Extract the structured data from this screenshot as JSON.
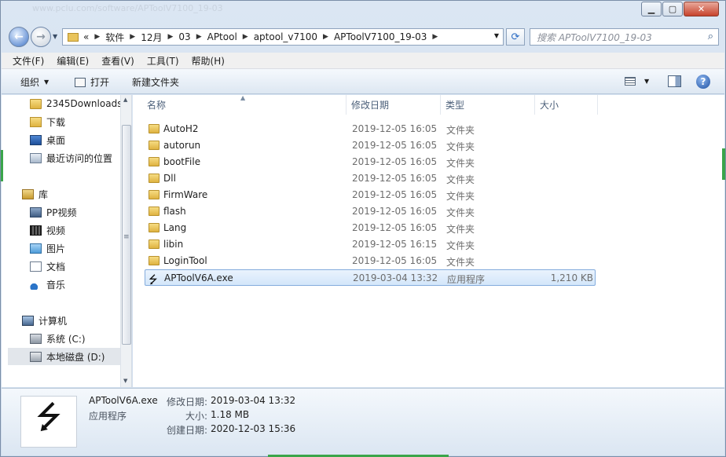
{
  "window": {
    "title": "www.pclu.com/software/APToolV7100_19-03"
  },
  "address": {
    "overflow": "«",
    "crumbs": [
      "软件",
      "12月",
      "03",
      "APtool",
      "aptool_v7100",
      "APToolV7100_19-03"
    ]
  },
  "search": {
    "placeholder": "搜索 APToolV7100_19-03"
  },
  "menu": [
    "文件(F)",
    "编辑(E)",
    "查看(V)",
    "工具(T)",
    "帮助(H)"
  ],
  "toolbar": {
    "organize": "组织",
    "open": "打开",
    "new_folder": "新建文件夹"
  },
  "nav": {
    "items": [
      {
        "label": "2345Downloads",
        "icon": "folder-icon"
      },
      {
        "label": "下载",
        "icon": "download-folder-icon"
      },
      {
        "label": "桌面",
        "icon": "desktop-icon"
      },
      {
        "label": "最近访问的位置",
        "icon": "recent-places-icon"
      },
      {
        "label": "库",
        "icon": "library-icon"
      },
      {
        "label": "PP视频",
        "icon": "pp-video-icon"
      },
      {
        "label": "视频",
        "icon": "video-library-icon"
      },
      {
        "label": "图片",
        "icon": "pictures-icon"
      },
      {
        "label": "文档",
        "icon": "documents-icon"
      },
      {
        "label": "音乐",
        "icon": "music-icon"
      },
      {
        "label": "计算机",
        "icon": "computer-icon"
      },
      {
        "label": "系统 (C:)",
        "icon": "drive-c-icon"
      },
      {
        "label": "本地磁盘 (D:)",
        "icon": "drive-d-icon"
      }
    ]
  },
  "columns": {
    "name": "名称",
    "date": "修改日期",
    "type": "类型",
    "size": "大小"
  },
  "files": [
    {
      "name": "AutoH2",
      "date": "2019-12-05 16:05",
      "type": "文件夹",
      "size": ""
    },
    {
      "name": "autorun",
      "date": "2019-12-05 16:05",
      "type": "文件夹",
      "size": ""
    },
    {
      "name": "bootFile",
      "date": "2019-12-05 16:05",
      "type": "文件夹",
      "size": ""
    },
    {
      "name": "Dll",
      "date": "2019-12-05 16:05",
      "type": "文件夹",
      "size": ""
    },
    {
      "name": "FirmWare",
      "date": "2019-12-05 16:05",
      "type": "文件夹",
      "size": ""
    },
    {
      "name": "flash",
      "date": "2019-12-05 16:05",
      "type": "文件夹",
      "size": ""
    },
    {
      "name": "Lang",
      "date": "2019-12-05 16:05",
      "type": "文件夹",
      "size": ""
    },
    {
      "name": "libin",
      "date": "2019-12-05 16:15",
      "type": "文件夹",
      "size": ""
    },
    {
      "name": "LoginTool",
      "date": "2019-12-05 16:05",
      "type": "文件夹",
      "size": ""
    },
    {
      "name": "APToolV6A.exe",
      "date": "2019-03-04 13:32",
      "type": "应用程序",
      "size": "1,210 KB"
    }
  ],
  "details": {
    "name": "APToolV6A.exe",
    "type": "应用程序",
    "modified_label": "修改日期:",
    "modified": "2019-03-04 13:32",
    "size_label": "大小:",
    "size": "1.18 MB",
    "created_label": "创建日期:",
    "created": "2020-12-03 15:36"
  }
}
